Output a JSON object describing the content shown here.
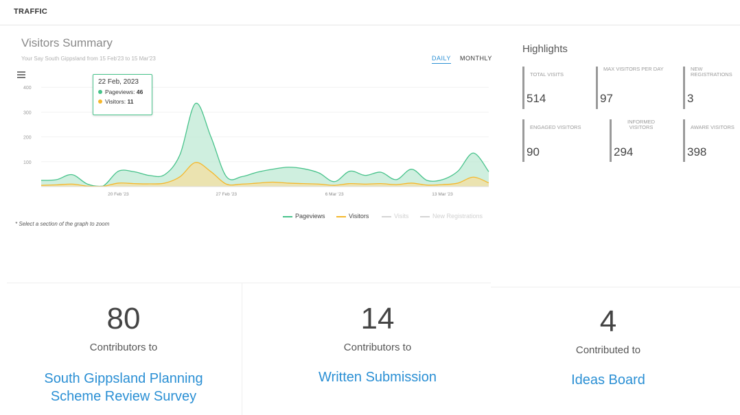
{
  "header": {
    "title": "TRAFFIC"
  },
  "chart_panel": {
    "title": "Visitors Summary",
    "subtitle": "Your Say South Gippsland from 15 Feb'23 to 15 Mar'23",
    "tabs": {
      "daily": "DAILY",
      "monthly": "MONTHLY"
    },
    "tooltip": {
      "date": "22 Feb, 2023",
      "pageviews_label": "Pageviews:",
      "pageviews_value": "46",
      "visitors_label": "Visitors:",
      "visitors_value": "11"
    },
    "zoom_note": "* Select a section of the graph to zoom"
  },
  "chart_data": {
    "type": "area",
    "y_ticks": [
      "400",
      "300",
      "200",
      "100"
    ],
    "x_tick_labels": [
      "20 Feb '23",
      "27 Feb '23",
      "6 Mar '23",
      "13 Mar '23"
    ],
    "ylim": [
      0,
      420
    ],
    "x": [
      "15 Feb",
      "16 Feb",
      "17 Feb",
      "18 Feb",
      "19 Feb",
      "20 Feb",
      "21 Feb",
      "22 Feb",
      "23 Feb",
      "24 Feb",
      "25 Feb",
      "26 Feb",
      "27 Feb",
      "28 Feb",
      "1 Mar",
      "2 Mar",
      "3 Mar",
      "4 Mar",
      "5 Mar",
      "6 Mar",
      "7 Mar",
      "8 Mar",
      "9 Mar",
      "10 Mar",
      "11 Mar",
      "12 Mar",
      "13 Mar",
      "14 Mar",
      "15 Mar"
    ],
    "series": [
      {
        "name": "Pageviews",
        "color": "#46c28a",
        "fill": "#bfe9d4",
        "values": [
          25,
          28,
          48,
          10,
          2,
          62,
          60,
          45,
          48,
          130,
          335,
          200,
          40,
          40,
          58,
          70,
          78,
          72,
          55,
          20,
          62,
          45,
          58,
          28,
          70,
          25,
          28,
          62,
          135,
          60
        ]
      },
      {
        "name": "Visitors",
        "color": "#f5b72b",
        "fill": "#f4dfa0",
        "values": [
          5,
          7,
          10,
          2,
          1,
          14,
          12,
          11,
          14,
          40,
          97,
          60,
          10,
          10,
          14,
          18,
          14,
          12,
          10,
          5,
          12,
          10,
          12,
          8,
          14,
          6,
          8,
          14,
          38,
          15
        ]
      },
      {
        "name": "Visits",
        "color": "#d4d4d4",
        "hidden": true
      },
      {
        "name": "New Registrations",
        "color": "#d4d4d4",
        "hidden": true
      }
    ],
    "legend_placement": "bottom-right"
  },
  "highlights": {
    "title": "Highlights",
    "cards": [
      {
        "label": "TOTAL VISITS",
        "value": "514"
      },
      {
        "label": "MAX VISITORS PER DAY",
        "value": "97"
      },
      {
        "label": "NEW REGISTRATIONS",
        "value": "3"
      },
      {
        "label": "ENGAGED VISITORS",
        "value": "90"
      },
      {
        "label": "INFORMED VISITORS",
        "value": "294"
      },
      {
        "label": "AWARE VISITORS",
        "value": "398"
      }
    ]
  },
  "contributions": [
    {
      "count": "80",
      "caption": "Contributors to",
      "link": "South Gippsland Planning Scheme Review Survey"
    },
    {
      "count": "14",
      "caption": "Contributors to",
      "link": "Written Submission"
    },
    {
      "count": "4",
      "caption": "Contributed to",
      "link": "Ideas Board"
    }
  ]
}
